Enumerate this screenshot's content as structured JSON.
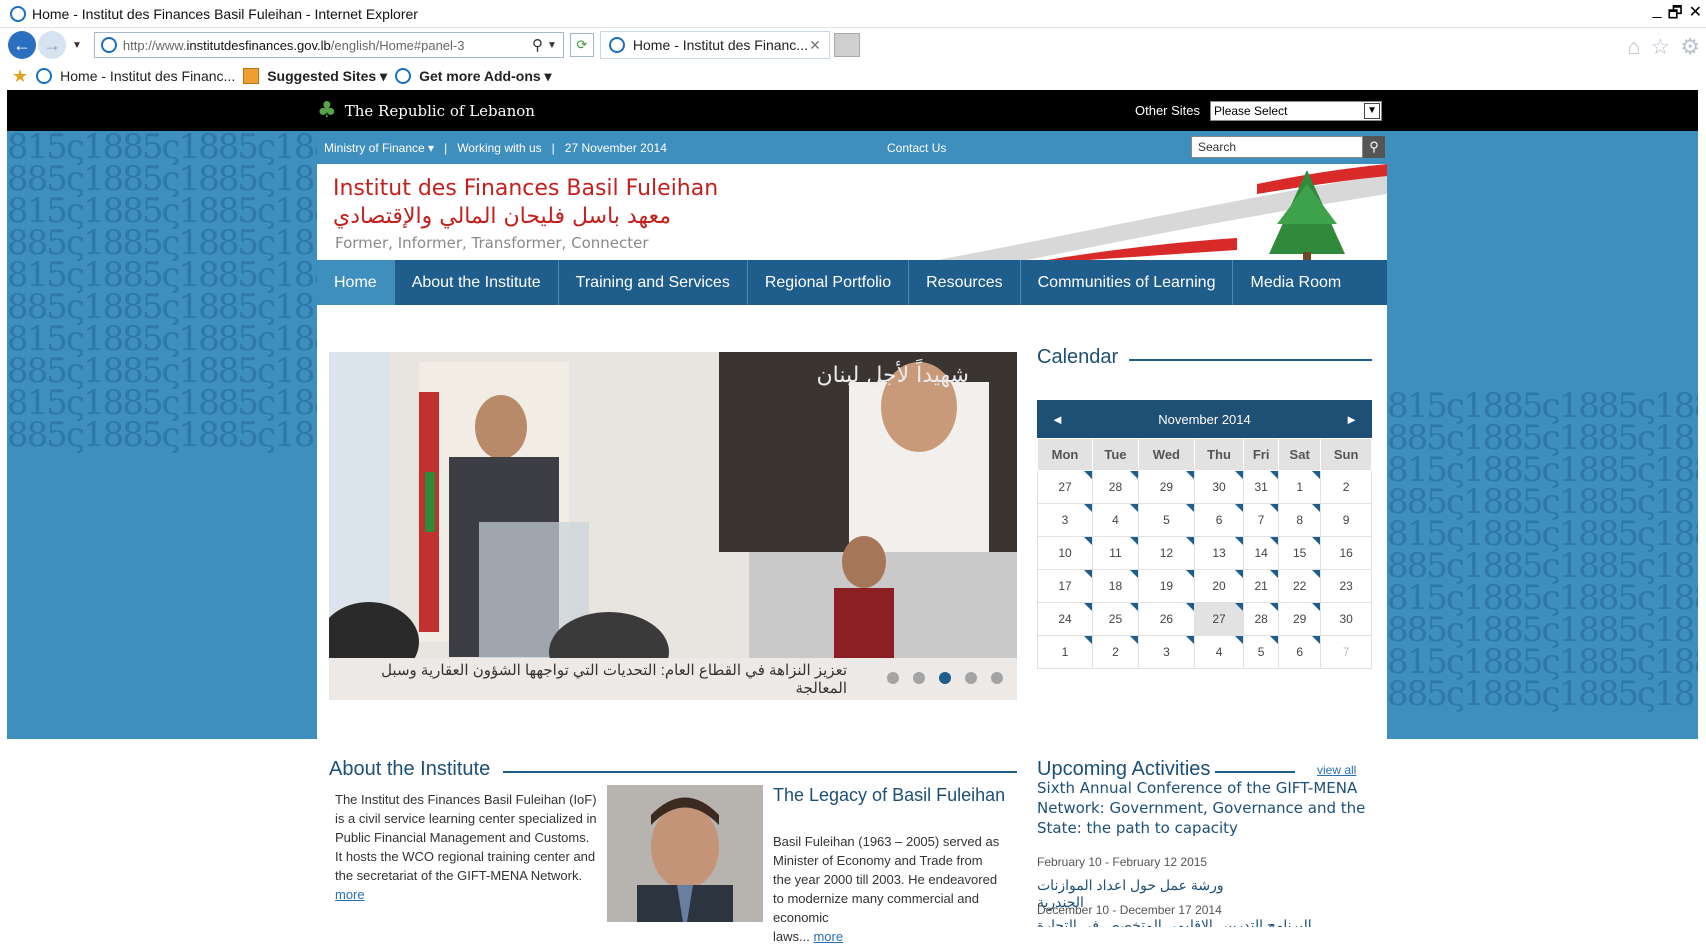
{
  "browser": {
    "window_title": "Home - Institut des Finances Basil Fuleihan - Internet Explorer",
    "url_prefix": "http://www.",
    "url_host": "institutdesfinances.gov.lb",
    "url_path": "/english/Home#panel-3",
    "tab_label": "Home - Institut des Financ...",
    "tab_close": "✕",
    "favorites": {
      "fav_item": "Home - Institut des Financ...",
      "suggested": "Suggested Sites ▾",
      "addons": "Get more Add-ons ▾"
    },
    "window_buttons": [
      "_",
      "🗗",
      "✕"
    ]
  },
  "topbar": {
    "republic": "The Republic of Lebanon",
    "other_sites_label": "Other Sites",
    "other_sites_value": "Please Select"
  },
  "utility": {
    "ministry": "Ministry of Finance ▾",
    "sep1": "|",
    "working": "Working with us",
    "sep2": "|",
    "date": "27 November 2014",
    "contact": "Contact Us",
    "search_placeholder": "Search"
  },
  "header": {
    "name_en": "Institut des Finances Basil Fuleihan",
    "name_ar": "معهد باسل فليحان المالي والإقتصادي",
    "tagline": "Former, Informer, Transformer, Connecter"
  },
  "nav": [
    "Home",
    "About the Institute",
    "Training and Services",
    "Regional Portfolio",
    "Resources",
    "Communities of Learning",
    "Media Room"
  ],
  "slider": {
    "caption": "تعزيز النزاهة في القطاع العام: التحديات التي تواجهها الشؤون العقارية وسبل المعالجة",
    "banner_ar": "شهيداً لأجل لبنان",
    "slide_count": 5,
    "active_slide": 3
  },
  "calendar": {
    "title": "Calendar",
    "month": "November 2014",
    "prev": "◄",
    "next": "►",
    "days": [
      "Mon",
      "Tue",
      "Wed",
      "Thu",
      "Fri",
      "Sat",
      "Sun"
    ],
    "weeks": [
      [
        "27",
        "28",
        "29",
        "30",
        "31",
        "1",
        "2"
      ],
      [
        "3",
        "4",
        "5",
        "6",
        "7",
        "8",
        "9"
      ],
      [
        "10",
        "11",
        "12",
        "13",
        "14",
        "15",
        "16"
      ],
      [
        "17",
        "18",
        "19",
        "20",
        "21",
        "22",
        "23"
      ],
      [
        "24",
        "25",
        "26",
        "27",
        "28",
        "29",
        "30"
      ],
      [
        "1",
        "2",
        "3",
        "4",
        "5",
        "6",
        "7"
      ]
    ]
  },
  "about": {
    "title": "About the Institute",
    "text": "The Institut des Finances Basil Fuleihan (IoF) is a civil service learning center specialized in Public Financial Management and Customs. It hosts the WCO regional training center and the secretariat of the GIFT-MENA Network.",
    "more": "more",
    "legacy_title": "The Legacy of Basil Fuleihan",
    "legacy_text": "Basil Fuleihan (1963 – 2005) served as Minister of Economy and Trade from the year 2000 till 2003. He endeavored to modernize many commercial and economic",
    "legacy_cut": "laws...",
    "legacy_more": "more"
  },
  "activities": {
    "title": "Upcoming Activities",
    "view_all": "view all",
    "items": [
      {
        "title": "Sixth Annual Conference of the GIFT-MENA Network: Government, Governance and the State: the path to capacity",
        "date": "February 10 - February 12 2015"
      },
      {
        "title": "ورشة عمل حول اعداد الموازنات الجندرية",
        "date": "December 10 - December 17 2014"
      },
      {
        "title": "البرنامج التدريبي الإقليمي المتخصص في التجارة العمومية",
        "date": ""
      }
    ]
  },
  "colors": {
    "primary_dark": "#1e4f75",
    "nav": "#1e5d8c",
    "pattern": "#3e8ebe",
    "brand_red": "#c3201e"
  }
}
